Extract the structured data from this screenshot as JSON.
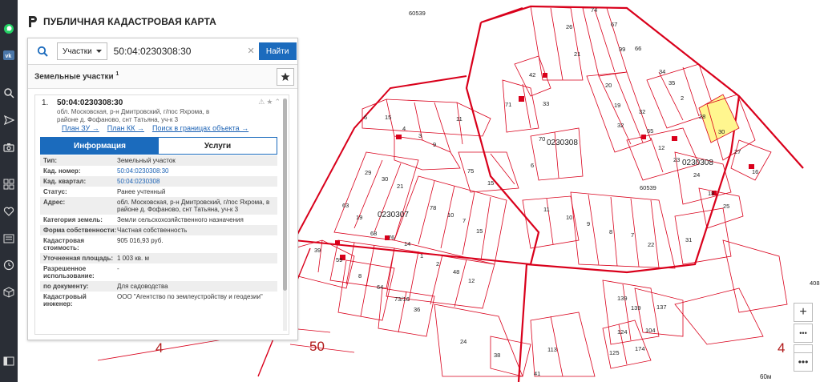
{
  "app": {
    "title": "ПУБЛИЧНАЯ КАДАСТРОВАЯ КАРТА"
  },
  "search": {
    "type_label": "Участки",
    "query": "50:04:0230308:30",
    "find_label": "Найти"
  },
  "results": {
    "title": "Земельные участки",
    "count": "1"
  },
  "card": {
    "num": "1.",
    "cad_number": "50:04:0230308:30",
    "address": "обл. Московская, р-н Дмитровский, г/пос Яхрома, в районе д. Фофаново, снт Татьяна, уч-к 3",
    "links": [
      "План ЗУ →",
      "План КК →",
      "Поиск в границах объекта →"
    ],
    "tabs": [
      "Информация",
      "Услуги"
    ],
    "rows": [
      {
        "k": "Тип:",
        "v": "Земельный участок"
      },
      {
        "k": "Кад. номер:",
        "v": "50:04:0230308:30"
      },
      {
        "k": "Кад. квартал:",
        "v": "50:04:0230308"
      },
      {
        "k": "Статус:",
        "v": "Ранее учтенный"
      },
      {
        "k": "Адрес:",
        "v": "обл. Московская, р-н Дмитровский, г/пос Яхрома, в районе д. Фофаново, снт Татьяна, уч-к 3"
      },
      {
        "k": "Категория земель:",
        "v": "Земли сельскохозяйственного назначения"
      },
      {
        "k": "Форма собственности:",
        "v": "Частная собственность"
      },
      {
        "k": "Кадастровая стоимость:",
        "v": "905 016,93 руб."
      },
      {
        "k": "Уточненная площадь:",
        "v": "1 003 кв. м"
      },
      {
        "k": "Разрешенное использование:",
        "v": "-"
      },
      {
        "k": "по документу:",
        "v": "Для садоводства"
      },
      {
        "k": "Кадастровый инженер:",
        "v": "ООО \"Агентство по землеустройству и геодезии\""
      }
    ]
  },
  "map": {
    "quarters": [
      "0230308",
      "0230307",
      "0230308"
    ],
    "zones": [
      "4",
      "50",
      "4"
    ],
    "scale": "60м",
    "plots": [
      "60539",
      "74",
      "26",
      "67",
      "21",
      "99",
      "66",
      "42",
      "71",
      "33",
      "20",
      "19",
      "32",
      "32",
      "34",
      "35",
      "2",
      "28",
      "30",
      "27",
      "16",
      "6",
      "15",
      "4",
      "11",
      "3",
      "9",
      "70",
      "65",
      "12",
      "23",
      "24",
      "18",
      "25",
      "60539",
      "6",
      "75",
      "15",
      "29",
      "30",
      "21",
      "78",
      "10",
      "7",
      "15",
      "11",
      "10",
      "9",
      "8",
      "7",
      "22",
      "31",
      "63",
      "19",
      "68",
      "76",
      "14",
      "1",
      "2",
      "48",
      "12",
      "39",
      "59",
      "8",
      "64",
      "73/16",
      "36",
      "24",
      "38",
      "113",
      "41",
      "139",
      "139",
      "137",
      "124",
      "104",
      "125",
      "174",
      "408"
    ]
  },
  "controls": {
    "zoom_in": "+",
    "zoom_out": "−",
    "more": "•••"
  },
  "colors": {
    "accent": "#1b6bbd",
    "parcel_line": "#d9001b",
    "selected": "#fff68f"
  }
}
